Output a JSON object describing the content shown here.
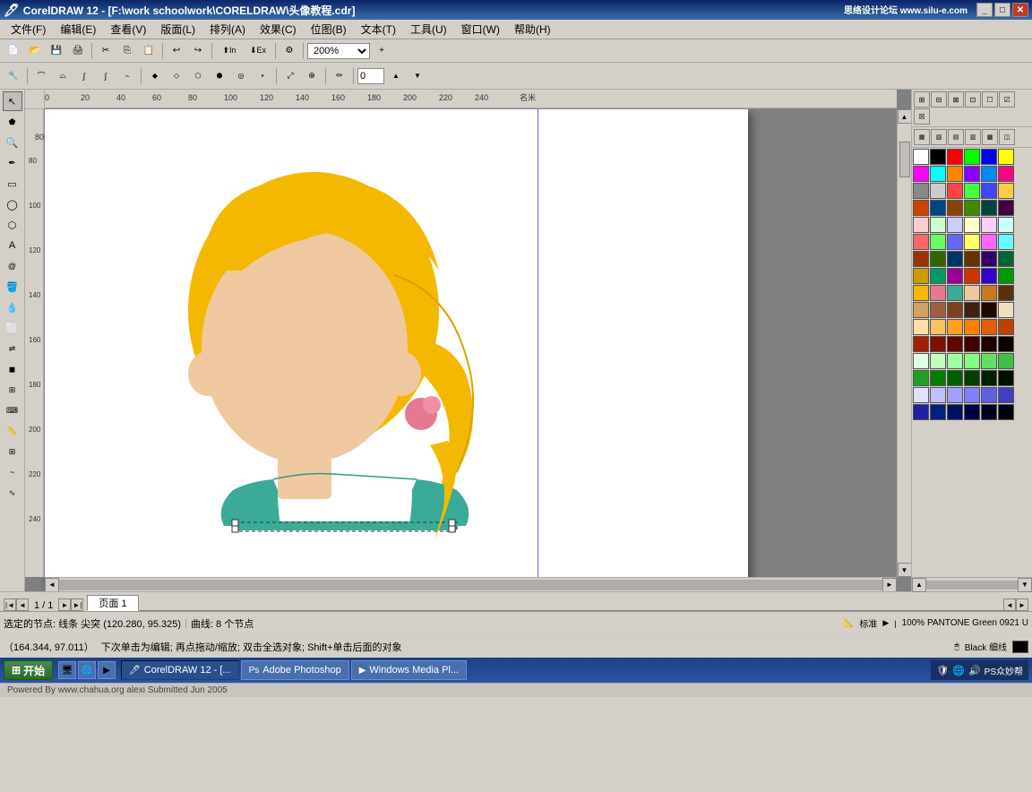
{
  "titleBar": {
    "title": "CorelDRAW 12 - [F:\\work schoolwork\\CORELDRAW\\头像教程.cdr]",
    "websiteText": "思络设计论坛 www.silu-e.com"
  },
  "menuBar": {
    "items": [
      "文件(F)",
      "编辑(E)",
      "查看(V)",
      "版面(L)",
      "排列(A)",
      "效果(C)",
      "位图(B)",
      "文本(T)",
      "工具(U)",
      "窗口(W)",
      "帮助(H)"
    ]
  },
  "toolbar": {
    "zoomValue": "200%"
  },
  "statusBar": {
    "line1": "选定的节点: 线条 尖突 (120.280, 95.325)",
    "line2": "曲线: 8 个节点",
    "coords": "（164.344, 97.011）",
    "hint": "下次单击为编辑; 再点拖动/缩放; 双击全选对象; Shift+单击后面的对象",
    "zoomPercent": "100% PANTONE Green 0921 U",
    "colorInfo": "Black 细线"
  },
  "pageTabs": {
    "current": "1 / 1",
    "activeTab": "页面 1"
  },
  "taskbar": {
    "startLabel": "开始",
    "items": [
      {
        "label": "CorelDRAW 12 - [..."
      },
      {
        "label": "Adobe Photoshop"
      },
      {
        "label": "Windows Media Pl..."
      }
    ],
    "watermark": "Powered By www.chahua.org alexi Submitted Jun 2005"
  },
  "colors": {
    "primary": "#f5b800",
    "skin": "#f0c8a0",
    "teal": "#3aab96",
    "pink": "#e87890",
    "background": "#888888",
    "canvas": "#ffffff"
  },
  "palette": {
    "swatches": [
      "#ffffff",
      "#000000",
      "#ff0000",
      "#00ff00",
      "#0000ff",
      "#ffff00",
      "#ff00ff",
      "#00ffff",
      "#ff8800",
      "#8800ff",
      "#0088ff",
      "#ff0088",
      "#888888",
      "#cccccc",
      "#ff4444",
      "#44ff44",
      "#4444ff",
      "#ffcc44",
      "#cc4400",
      "#004488",
      "#884400",
      "#448800",
      "#004444",
      "#440044",
      "#ffcccc",
      "#ccffcc",
      "#ccccff",
      "#ffffcc",
      "#ffccff",
      "#ccffff",
      "#ff6666",
      "#66ff66",
      "#6666ff",
      "#ffff66",
      "#ff66ff",
      "#66ffff",
      "#993300",
      "#336600",
      "#003366",
      "#663300",
      "#330066",
      "#006633",
      "#cc9900",
      "#009966",
      "#990099",
      "#cc3300",
      "#3300cc",
      "#009900",
      "#f5b800",
      "#e87890",
      "#3aab96",
      "#f0c8a0",
      "#c87820",
      "#5a3010",
      "#d4a060",
      "#a06040",
      "#804020",
      "#402010",
      "#200800",
      "#f0e0c0",
      "#ffe0a0",
      "#ffc060",
      "#ffa020",
      "#ff8000",
      "#e06000",
      "#c04000",
      "#a02000",
      "#801000",
      "#600800",
      "#400000",
      "#200000",
      "#100000",
      "#e0ffe0",
      "#c0ffc0",
      "#a0ffa0",
      "#80ff80",
      "#60e060",
      "#40c040",
      "#20a020",
      "#008000",
      "#006000",
      "#004000",
      "#002000",
      "#001000",
      "#e0e0ff",
      "#c0c0ff",
      "#a0a0ff",
      "#8080ff",
      "#6060e0",
      "#4040c0",
      "#2020a0",
      "#002080",
      "#001060",
      "#000040",
      "#000020",
      "#000010"
    ]
  }
}
